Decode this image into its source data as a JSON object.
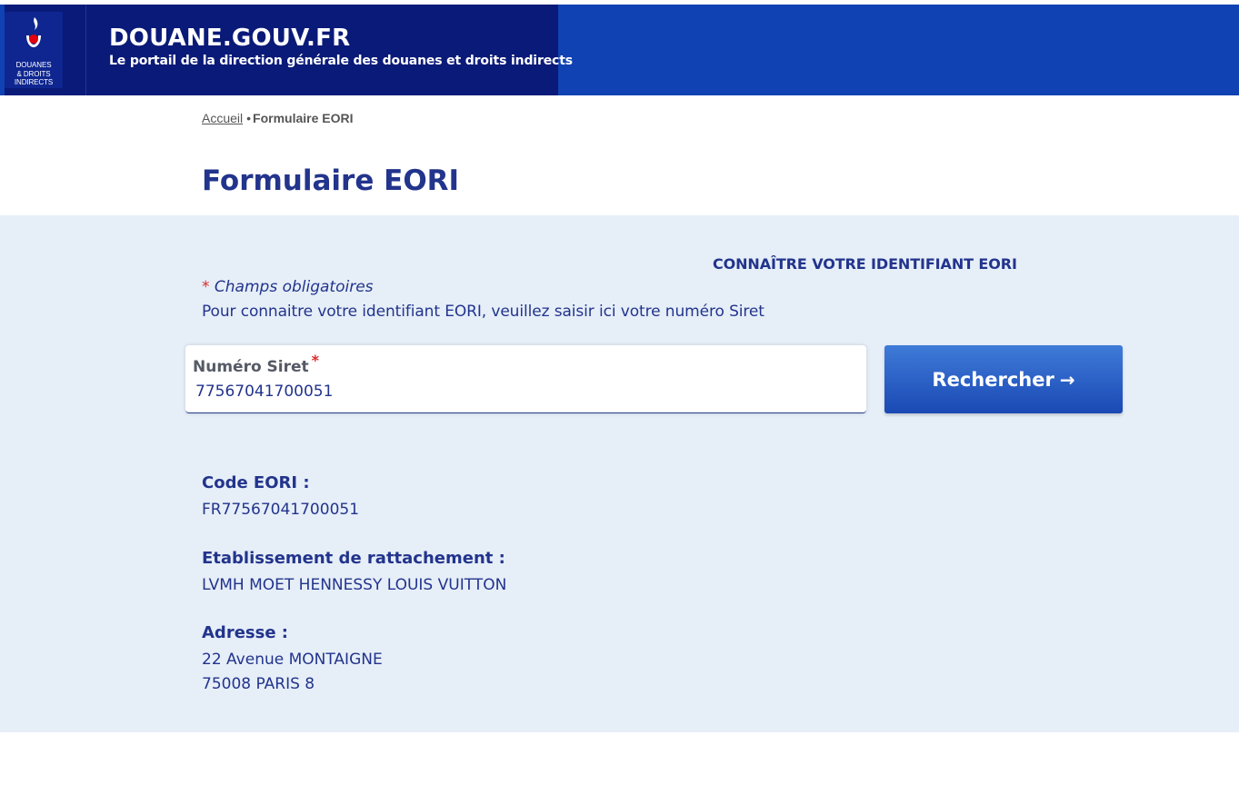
{
  "header": {
    "logo_text": [
      "DOUANES",
      "& DROITS",
      "INDIRECTS"
    ],
    "site_title": "DOUANE.GOUV.FR",
    "site_subtitle": "Le portail de la direction générale des douanes et droits indirects"
  },
  "breadcrumb": {
    "home": "Accueil",
    "separator": "•",
    "current": "Formulaire EORI"
  },
  "page_title": "Formulaire EORI",
  "form": {
    "section_heading": "CONNAÎTRE VOTRE IDENTIFIANT EORI",
    "required_star": "*",
    "required_note": "Champs obligatoires",
    "instructions": "Pour connaitre votre identifiant EORI, veuillez saisir ici votre numéro Siret",
    "siret_label": "Numéro Siret",
    "siret_value": "77567041700051",
    "search_button": "Rechercher",
    "search_arrow": "→"
  },
  "results": {
    "eori_label": "Code EORI :",
    "eori_value": "FR77567041700051",
    "establishment_label": "Etablissement de rattachement :",
    "establishment_value": "LVMH MOET HENNESSY LOUIS VUITTON",
    "address_label": "Adresse :",
    "address_line1": "22 Avenue MONTAIGNE",
    "address_line2": "75008 PARIS 8"
  },
  "colors": {
    "header_blue": "#1042b3",
    "header_dark": "#0a1a78",
    "title_blue": "#22348c",
    "panel_bg": "#e6eef8",
    "required_red": "#d92b2b"
  }
}
